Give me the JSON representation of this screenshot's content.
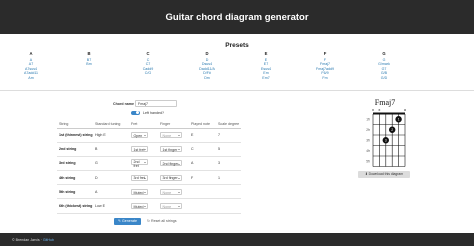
{
  "header": {
    "title": "Guitar chord diagram generator"
  },
  "presets": {
    "title": "Presets",
    "columns": [
      {
        "head": "A",
        "items": [
          "A",
          "A7",
          "A7sus4",
          "A7add11",
          "Am"
        ]
      },
      {
        "head": "B",
        "items": [
          "B7",
          "Bm"
        ]
      },
      {
        "head": "C",
        "items": [
          "C",
          "C7",
          "Cadd9",
          "C/G"
        ]
      },
      {
        "head": "D",
        "items": [
          "D",
          "Dsus4",
          "Dadd11/A",
          "D/F#",
          "Dm"
        ]
      },
      {
        "head": "E",
        "items": [
          "E",
          "E7",
          "Esus4",
          "Em",
          "Em7"
        ]
      },
      {
        "head": "F",
        "items": [
          "F",
          "Fmaj7",
          "Fmaj7add9",
          "F6/9",
          "Fm"
        ]
      },
      {
        "head": "G",
        "items": [
          "G",
          "G/mark",
          "G7",
          "G/B",
          "G/D"
        ]
      }
    ]
  },
  "form": {
    "chord_name_label": "Chord name",
    "chord_name_value": "Fmaj7",
    "left_handed_label": "Left handed?",
    "headers": [
      "String",
      "Standard tuning",
      "Fret",
      "Finger",
      "Played note",
      "Scale degree"
    ],
    "rows": [
      {
        "name": "1st (thinnest) string",
        "tuning": "High E",
        "fret": "Open",
        "finger": "None",
        "note": "E",
        "degree": "7"
      },
      {
        "name": "2nd string",
        "tuning": "B",
        "fret": "1st fret",
        "finger": "1st finger",
        "note": "C",
        "degree": "5"
      },
      {
        "name": "3rd string",
        "tuning": "G",
        "fret": "2nd fret",
        "finger": "2nd finger",
        "note": "A",
        "degree": "3"
      },
      {
        "name": "4th string",
        "tuning": "D",
        "fret": "3rd fret",
        "finger": "3rd finger",
        "note": "F",
        "degree": "1"
      },
      {
        "name": "5th string",
        "tuning": "A",
        "fret": "Muted",
        "finger": "None",
        "note": "",
        "degree": ""
      },
      {
        "name": "6th (thickest) string",
        "tuning": "Low E",
        "fret": "Muted",
        "finger": "None",
        "note": "",
        "degree": ""
      }
    ],
    "generate_label": "Generate",
    "reset_label": "Reset all strings"
  },
  "diagram": {
    "title": "Fmaj7",
    "fret_labels": [
      "1fr",
      "2fr",
      "3fr",
      "4fr",
      "5fr"
    ],
    "string_markers": [
      "x",
      "x",
      "",
      "",
      "",
      "o"
    ],
    "fingers": [
      {
        "string": 2,
        "fret": 1,
        "label": "1"
      },
      {
        "string": 3,
        "fret": 2,
        "label": "2"
      },
      {
        "string": 4,
        "fret": 3,
        "label": "3"
      }
    ],
    "download_label": "Download this diagram"
  },
  "footer": {
    "text": "© Brendan Jarvis · ",
    "link": "GitHub"
  }
}
